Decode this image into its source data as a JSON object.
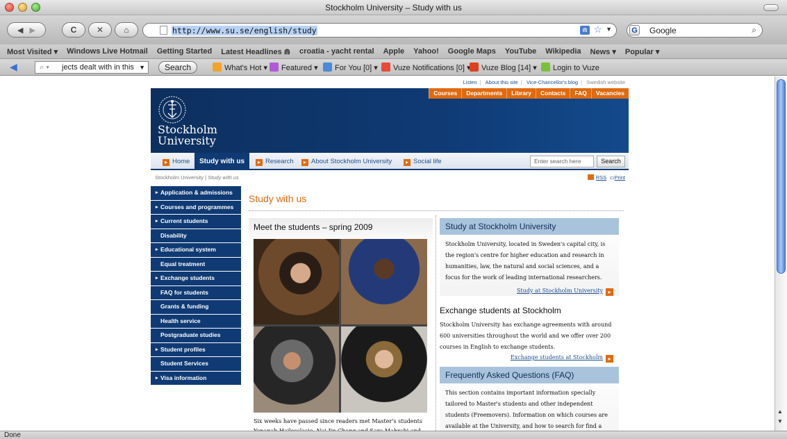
{
  "window": {
    "title": "Stockholm University – Study with us"
  },
  "nav": {
    "url": "http://www.su.se/english/study",
    "search_engine": "Google"
  },
  "bookmarks": [
    "Most Visited ▾",
    "Windows Live Hotmail",
    "Getting Started",
    "Latest Headlines ⋒",
    "croatia - yacht rental",
    "Apple",
    "Yahoo!",
    "Google Maps",
    "YouTube",
    "Wikipedia",
    "News ▾",
    "Popular ▾"
  ],
  "toolbar": {
    "search_value": "jects dealt with in this",
    "search_button": "Search",
    "items": [
      "What's Hot",
      "Featured",
      "For You [0]",
      "Vuze Notifications [0]",
      "Vuze Blog [14]",
      "Login to Vuze"
    ]
  },
  "status": "Done",
  "site": {
    "toplinks": [
      "Listen",
      "About this site",
      "Vice-Chancellor's blog",
      "Swedish website"
    ],
    "topnav": [
      "Courses",
      "Departments",
      "Library",
      "Contacts",
      "FAQ",
      "Vacancies"
    ],
    "logo_line1": "Stockholm",
    "logo_line2": "University",
    "mainnav": {
      "home": "Home",
      "active": "Study with us",
      "research": "Research",
      "about": "About Stockholm University",
      "social": "Social life"
    },
    "search_placeholder": "Enter search here",
    "search_button": "Search",
    "breadcrumb_home": "Stockholm University",
    "breadcrumb_sep": "|",
    "breadcrumb_current": "Study with us",
    "rss": "RSS",
    "print": "Print",
    "sidenav": [
      {
        "label": "Application & admissions",
        "arrow": true
      },
      {
        "label": "Courses and programmes",
        "arrow": true
      },
      {
        "label": "Current students",
        "arrow": true
      },
      {
        "label": "Disability",
        "arrow": false
      },
      {
        "label": "Educational system",
        "arrow": true
      },
      {
        "label": "Equal treatment",
        "arrow": false
      },
      {
        "label": "Exchange students",
        "arrow": true
      },
      {
        "label": "FAQ for students",
        "arrow": false
      },
      {
        "label": "Grants & funding",
        "arrow": false
      },
      {
        "label": "Health service",
        "arrow": false
      },
      {
        "label": "Postgraduate studies",
        "arrow": false
      },
      {
        "label": "Student profiles",
        "arrow": true
      },
      {
        "label": "Student Services",
        "arrow": false
      },
      {
        "label": "Visa information",
        "arrow": true
      }
    ],
    "page_title": "Study with us",
    "col1": {
      "heading": "Meet the students – spring 2009",
      "text": "Six weeks have passed since readers met Master's students Yonanah Hailesslasie, Nai-Jin Chang and Sara Mahrabi and"
    },
    "box1": {
      "heading": "Study at Stockholm University",
      "text": "Stockholm University, located in Sweden's capital city, is the region's centre for higher education and research in humanities, law, the natural and social sciences, and a focus for the work of leading international researchers.",
      "link": "Study at Stockholm University"
    },
    "box2": {
      "heading": "Exchange students at Stockholm",
      "text": "Stockholm University has exchange agreements with around 600 universities throughout the world and we offer over 200 courses in English to exchange students.",
      "link": "Exchange students at Stockholm"
    },
    "box3": {
      "heading": "Frequently Asked Questions (FAQ)",
      "text": "This section contains important information specially tailored to Master's students and other independent students (Freemovers). Information on which courses are available at the University, and how to search for find a course can also be"
    }
  }
}
